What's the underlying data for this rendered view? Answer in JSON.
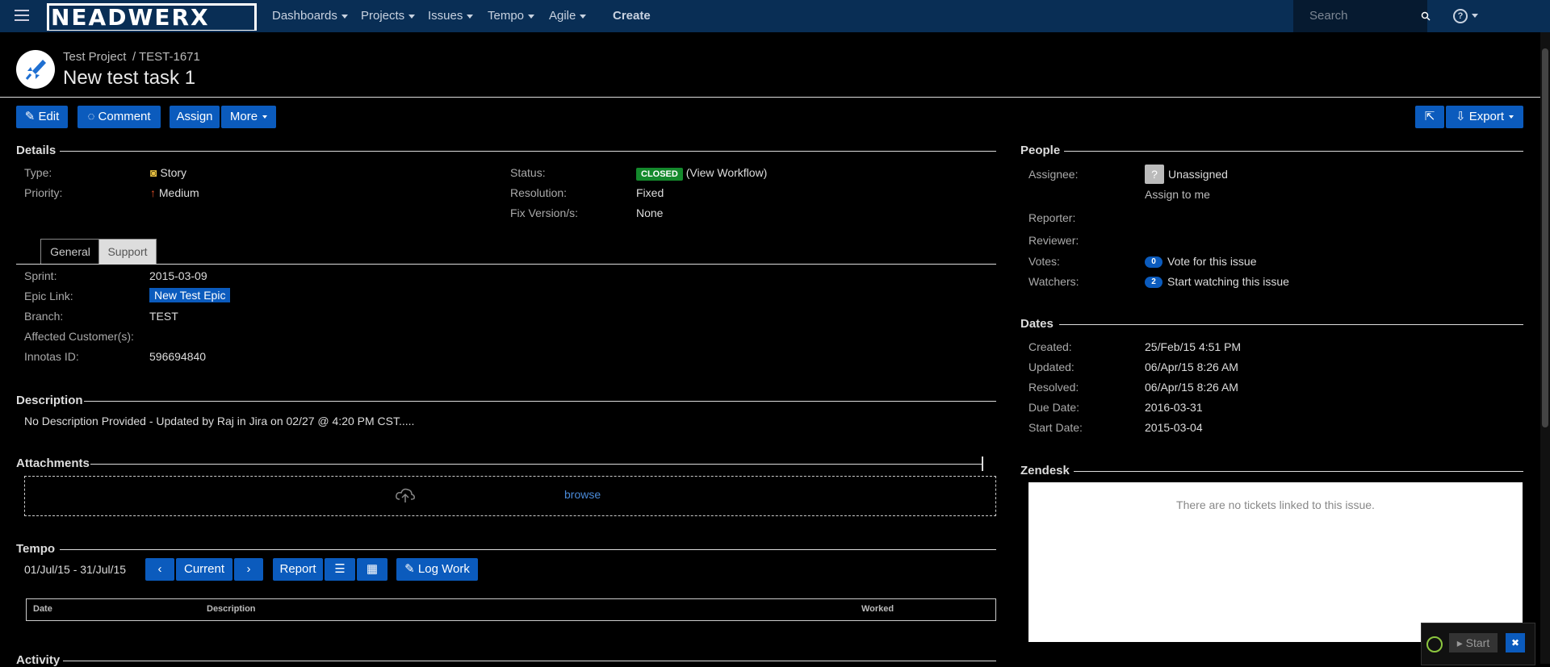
{
  "nav": {
    "logo": "NEADWERX",
    "items": [
      "Dashboards",
      "Projects",
      "Issues",
      "Tempo",
      "Agile"
    ],
    "create": "Create",
    "search_placeholder": "Search"
  },
  "issue": {
    "project": "Test Project",
    "key": "TEST-1671",
    "title": "New test task 1"
  },
  "toolbar": {
    "edit": "Edit",
    "comment": "Comment",
    "assign": "Assign",
    "more": "More",
    "export": "Export"
  },
  "details": {
    "header": "Details",
    "type_label": "Type:",
    "type": "Story",
    "priority_label": "Priority:",
    "priority": "Medium",
    "status_label": "Status:",
    "status": "CLOSED",
    "workflow": "(View Workflow)",
    "resolution_label": "Resolution:",
    "resolution": "Fixed",
    "fixversion_label": "Fix Version/s:",
    "fixversion": "None",
    "tabs": [
      "General",
      "Support"
    ],
    "sprint_label": "Sprint:",
    "sprint": "2015-03-09",
    "epic_label": "Epic Link:",
    "epic": "New Test Epic",
    "branch_label": "Branch:",
    "branch": "TEST",
    "customers_label": "Affected Customer(s):",
    "innotas_label": "Innotas ID:",
    "innotas": "596694840"
  },
  "description": {
    "header": "Description",
    "text": "No Description Provided - Updated by Raj in Jira on 02/27 @ 4:20 PM CST....."
  },
  "attachments": {
    "header": "Attachments",
    "browse": "browse"
  },
  "tempo": {
    "header": "Tempo",
    "range": "01/Jul/15 - 31/Jul/15",
    "current": "Current",
    "report": "Report",
    "log_work": "Log Work",
    "cols": [
      "Date",
      "Description",
      "Worked"
    ]
  },
  "activity": {
    "header": "Activity"
  },
  "people": {
    "header": "People",
    "assignee_label": "Assignee:",
    "assignee": "Unassigned",
    "assign_me": "Assign to me",
    "reporter_label": "Reporter:",
    "reviewer_label": "Reviewer:",
    "votes_label": "Votes:",
    "votes_count": "0",
    "votes_text": "Vote for this issue",
    "watchers_label": "Watchers:",
    "watchers_count": "2",
    "watchers_text": "Start watching this issue"
  },
  "dates": {
    "header": "Dates",
    "created_label": "Created:",
    "created": "25/Feb/15 4:51 PM",
    "updated_label": "Updated:",
    "updated": "06/Apr/15 8:26 AM",
    "resolved_label": "Resolved:",
    "resolved": "06/Apr/15 8:26 AM",
    "due_label": "Due Date:",
    "due": "2016-03-31",
    "start_label": "Start Date:",
    "start": "2015-03-04"
  },
  "zendesk": {
    "header": "Zendesk",
    "empty": "There are no tickets linked to this issue."
  },
  "timer": {
    "start": "Start"
  },
  "colors": {
    "nav_bg": "#092e55",
    "button": "#0b5bbd",
    "closed": "#14892c"
  }
}
